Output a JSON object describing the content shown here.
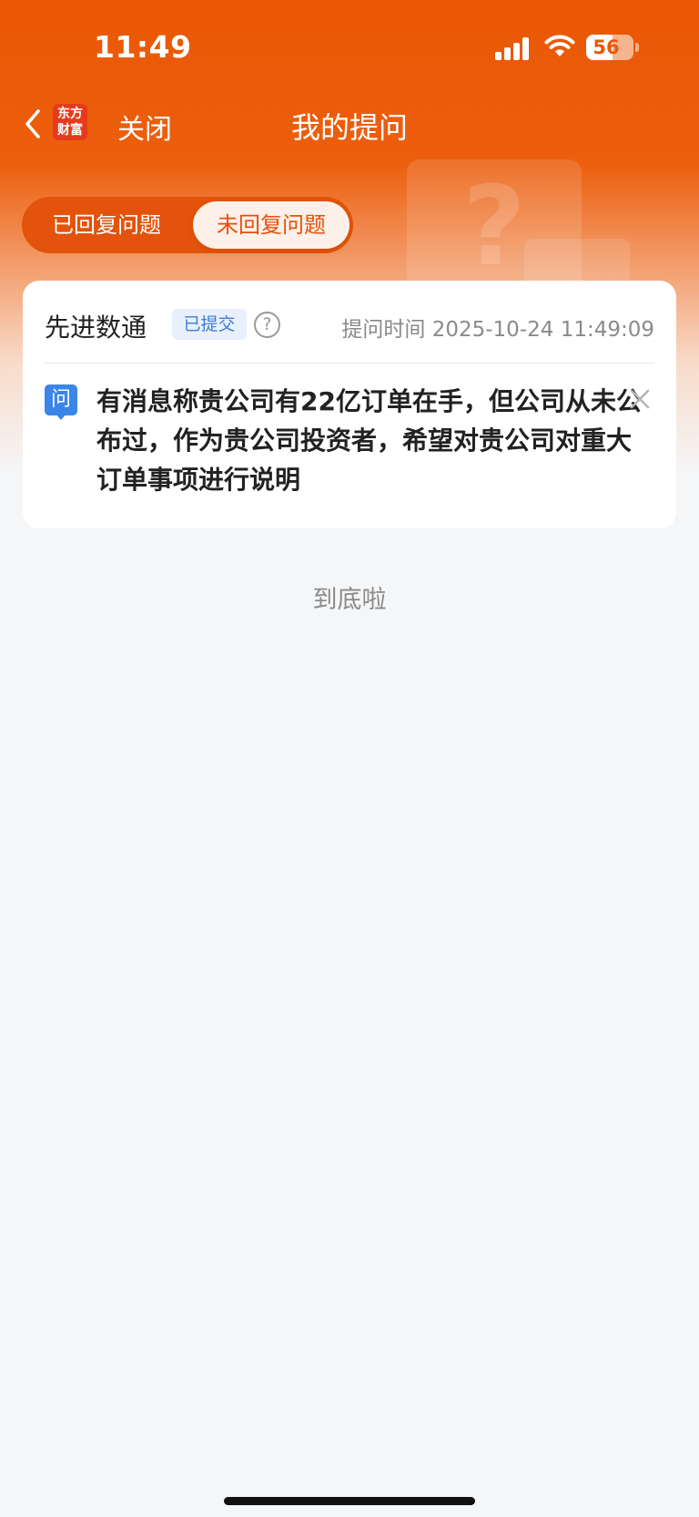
{
  "status_bar": {
    "time": "11:49",
    "battery_level": 56,
    "battery_text": "56",
    "signal_icon": "cellular-signal-icon",
    "wifi_icon": "wifi-icon"
  },
  "nav": {
    "logo_text": "东方财富",
    "logo_line1": "东方",
    "logo_line2": "财富",
    "close_label": "关闭",
    "title": "我的提问"
  },
  "tabs": [
    {
      "label": "已回复问题",
      "active": false
    },
    {
      "label": "未回复问题",
      "active": true
    }
  ],
  "question_card": {
    "company": "先进数通",
    "status": "已提交",
    "help_symbol": "?",
    "ask_time": "提问时间 2025-10-24 11:49:09",
    "question_badge": "问",
    "question_text": "有消息称贵公司有22亿订单在手，但公司从未公布过，作为贵公司投资者，希望对贵公司对重大订单事项进行说明"
  },
  "footer": {
    "end_text": "到底啦"
  },
  "colors": {
    "brand_orange": "#ea5704",
    "badge_blue": "#3a86e8",
    "page_background": "#f5f6f8"
  }
}
